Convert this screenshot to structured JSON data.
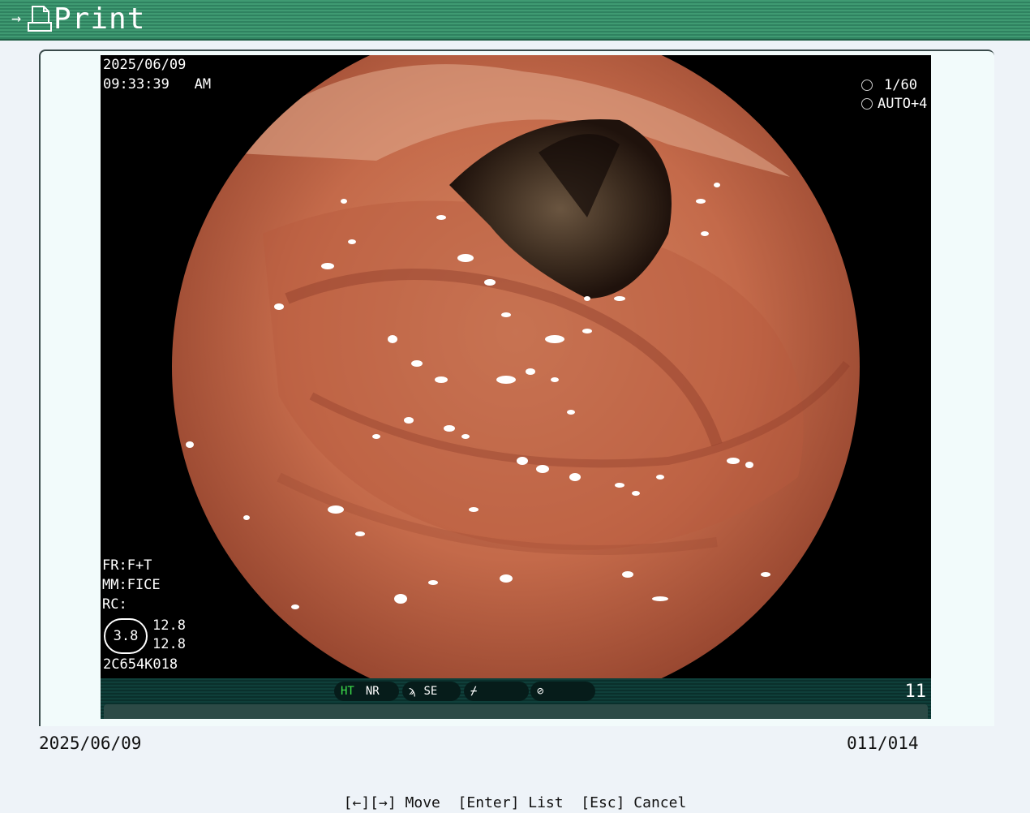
{
  "window": {
    "title": "Print",
    "icon": "print-icon"
  },
  "overlay": {
    "date": "2025/06/09",
    "time": "09:33:39   AM",
    "shutter": "1/60",
    "iris": "AUTO+4",
    "fr": "FR:F+T",
    "mm": "MM:FICE",
    "rc": "RC:",
    "gauge_value": "3.8",
    "gauge_top": "12.8",
    "gauge_bottom": "12.8",
    "scope_id": "2C654K018",
    "frame_number": "11"
  },
  "status_pills": {
    "ht": "HT",
    "nr": "NR",
    "se": "SE"
  },
  "footer": {
    "date": "2025/06/09",
    "counter": "011/014",
    "hint": "[←][→] Move  [Enter] List  [Esc] Cancel"
  },
  "colors": {
    "titlebar": "#3f9a72",
    "ht_indicator": "#3ee24b",
    "mucosa": "#c46a4a"
  }
}
